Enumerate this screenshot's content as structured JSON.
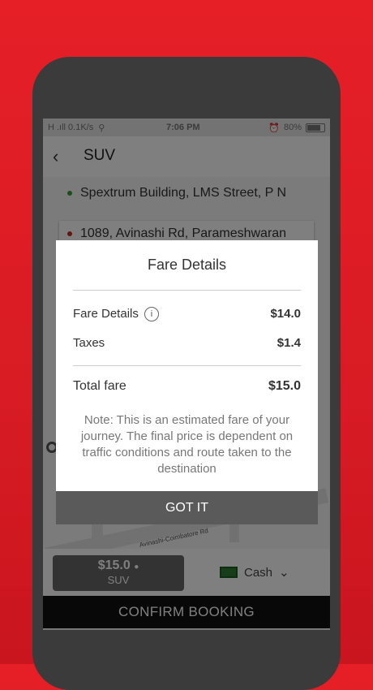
{
  "status_bar": {
    "network": "H .ıll 0.1K/s",
    "time": "7:06 PM",
    "battery": "80%"
  },
  "header": {
    "back_icon": "back-arrow-icon",
    "title": "SUV"
  },
  "locations": {
    "pickup": "Spextrum Building, LMS Street, P N",
    "drop": "1089, Avinashi Rd, Parameshwaran"
  },
  "map": {
    "road_label": "Avinashi-Coimbatore Rd"
  },
  "bottom": {
    "fare_amount": "$15.0",
    "vehicle_type": "SUV",
    "payment_method": "Cash",
    "confirm_label": "CONFIRM BOOKING"
  },
  "dialog": {
    "title": "Fare Details",
    "rows": [
      {
        "label": "Fare Details",
        "value": "$14.0"
      },
      {
        "label": "Taxes",
        "value": "$1.4"
      }
    ],
    "total": {
      "label": "Total fare",
      "value": "$15.0"
    },
    "note": "Note: This is an estimated fare of your journey. The final price is dependent on traffic conditions and route taken to the destination",
    "button_label": "GOT IT"
  },
  "colors": {
    "background": "#e61f26",
    "pickup_dot": "#2e9e3a",
    "drop_dot": "#c62828"
  }
}
